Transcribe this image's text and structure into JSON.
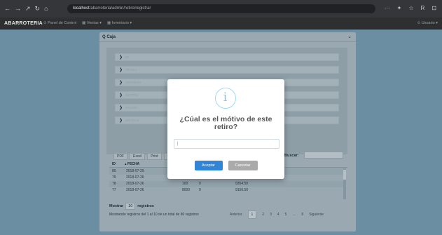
{
  "browser": {
    "nav_icons": [
      "←",
      "→",
      "↗",
      "↻",
      "⌂"
    ],
    "url_host": "localhost",
    "url_path": "/abarroteria/admin/retiro/registrar",
    "ext_icons": [
      "⋯",
      "✦",
      "☆",
      "R",
      "⊡"
    ]
  },
  "appnav": {
    "brand": "ABARROTERIA",
    "menu": [
      "⊙ Panel de Control",
      "▦ Ventas ▾",
      "▦ Inventario ▾"
    ],
    "user": "⊙ Usuario ▾"
  },
  "panel": {
    "title": "Q Caja",
    "chevron": "⌄",
    "filter_rows": [
      {
        "arrow": "❯",
        "label": "ID"
      },
      {
        "arrow": "❯",
        "label": "FECHA"
      },
      {
        "arrow": "❯",
        "label": "INGRESO"
      },
      {
        "arrow": "❯",
        "label": "RETIRO"
      },
      {
        "arrow": "❯",
        "label": "SALDO"
      },
      {
        "arrow": "❯",
        "label": "MOTIVO"
      }
    ]
  },
  "table": {
    "buttons": [
      "PDF",
      "Excel",
      "Print",
      "Copy"
    ],
    "search_label": "Buscar:",
    "columns": [
      {
        "label": "ID"
      },
      {
        "label": "▴  FECHA"
      },
      {
        "label": "IN"
      }
    ],
    "rows": [
      {
        "id": "80",
        "fecha": "2018-07-29",
        "ingreso": "4†",
        "retiro": "",
        "saldo": ""
      },
      {
        "id": "79",
        "fecha": "2018-07-26",
        "ingreso": "390",
        "retiro": "0",
        "saldo": "9854.50"
      },
      {
        "id": "78",
        "fecha": "2018-07-26",
        "ingreso": "100",
        "retiro": "0",
        "saldo": "9354.50"
      },
      {
        "id": "77",
        "fecha": "2018-07-26",
        "ingreso": "8000",
        "retiro": "0",
        "saldo": "9156.50"
      }
    ],
    "show_label": "Mostrar",
    "show_value": "10",
    "records_label": "registros",
    "info": "Mostrando registros del 1 al 10 de un total de 80 registros",
    "pager": {
      "prev": "Anterior",
      "pages": [
        "1",
        "2",
        "3",
        "4",
        "5",
        "…",
        "8"
      ],
      "next": "Siguiente"
    }
  },
  "modal": {
    "icon_glyph": "i",
    "title": "¿Cúal es el mótivo de este retiro?",
    "input_value": "|",
    "confirm_label": "Aceptar",
    "cancel_label": "Cancelar",
    "confirm_color": "#3085d6",
    "cancel_color": "#aaaaaa"
  }
}
